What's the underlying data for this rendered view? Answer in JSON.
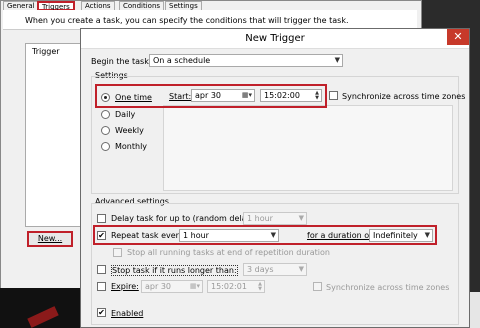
{
  "bg": {
    "tabs": [
      "General",
      "Triggers",
      "Actions",
      "Conditions",
      "Settings"
    ],
    "description": "When you create a task, you can specify the conditions that will trigger the task.",
    "column_trigger": "Trigger",
    "new_button": "New..."
  },
  "dialog": {
    "title": "New Trigger",
    "close_glyph": "✕",
    "begin_label": "Begin the task:",
    "begin_value": "On a schedule",
    "settings_label": "Settings",
    "schedule": [
      "One time",
      "Daily",
      "Weekly",
      "Monthly"
    ],
    "start_label": "Start:",
    "start_date": "apr  30",
    "start_time": "15:02:00",
    "sync_label": "Synchronize across time zones",
    "advanced_label": "Advanced settings",
    "delay_label": "Delay task for up to (random delay):",
    "delay_value": "1 hour",
    "repeat_label": "Repeat task every:",
    "repeat_value": "1 hour",
    "duration_label": "for a duration of:",
    "duration_value": "Indefinitely",
    "stop_running_label": "Stop all running tasks at end of repetition duration",
    "stop_longer_label": "Stop task if it runs longer than:",
    "stop_longer_value": "3 days",
    "expire_label": "Expire:",
    "expire_date": "apr  30",
    "expire_time": "15:02:01",
    "expire_sync_label": "Synchronize across time zones",
    "enabled_label": "Enabled",
    "check_glyph": "✔",
    "combo_arrow": "▼",
    "calendar_icon": "calendar-icon",
    "spinner_icon": "spinner-icon"
  },
  "colors": {
    "highlight": "#c0202a",
    "close": "#c7392a"
  }
}
